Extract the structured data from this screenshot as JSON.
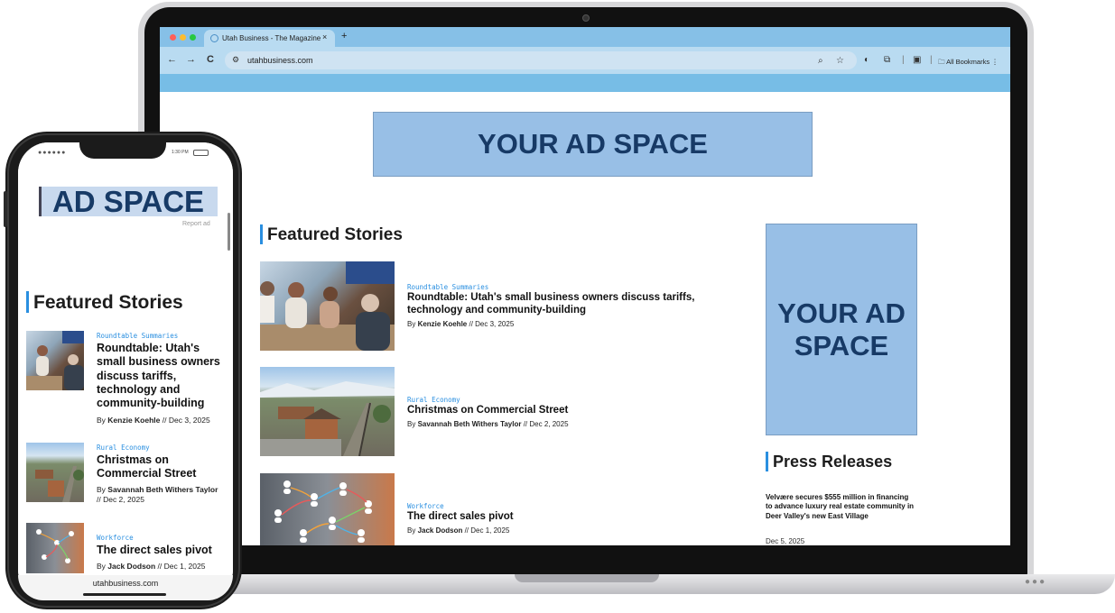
{
  "browser": {
    "tab_title": "Utah Business - The Magazine",
    "tab_close": "×",
    "new_tab": "+",
    "back": "←",
    "forward": "→",
    "reload": "C",
    "url": "utahbusiness.com",
    "all_bookmarks": "All Bookmarks",
    "traffic_colors": [
      "#ff5f57",
      "#febc2e",
      "#28c840"
    ]
  },
  "laptop_page": {
    "top_ad": "YOUR AD SPACE",
    "featured_title": "Featured Stories",
    "stories": [
      {
        "category": "Roundtable Summaries",
        "title": "Roundtable: Utah's small business owners discuss tariffs, technology and community-building",
        "by": "By ",
        "author": "Kenzie Koehle",
        "date": " // Dec 3, 2025"
      },
      {
        "category": "Rural Economy",
        "title": "Christmas on Commercial Street",
        "by": "By ",
        "author": "Savannah Beth Withers Taylor",
        "date": " // Dec 2, 2025"
      },
      {
        "category": "Workforce",
        "title": "The direct sales pivot",
        "by": "By ",
        "author": "Jack Dodson",
        "date": " // Dec 1, 2025"
      }
    ],
    "side_ad": "YOUR AD SPACE",
    "press_title": "Press Releases",
    "press_item_title": "Velvære secures $555 million in financing to advance luxury real estate community in Deer Valley's new East Village",
    "press_item_date": "Dec 5, 2025"
  },
  "phone": {
    "status_time": "1:30 PM",
    "ad": "AD SPACE",
    "report_ad": "Report ad",
    "featured_title": "Featured Stories",
    "stories": [
      {
        "category": "Roundtable Summaries",
        "title": "Roundtable: Utah's small business owners discuss tariffs, technology and community-building",
        "by": "By ",
        "author": "Kenzie Koehle",
        "date": " // Dec 3, 2025"
      },
      {
        "category": "Rural Economy",
        "title": "Christmas on Commercial Street",
        "by": "By ",
        "author": "Savannah Beth Withers Taylor",
        "date": " // Dec 2, 2025"
      },
      {
        "category": "Workforce",
        "title": "The direct sales pivot",
        "by": "By ",
        "author": "Jack Dodson",
        "date": " // Dec 1, 2025"
      }
    ],
    "url": "utahbusiness.com"
  },
  "colors": {
    "accent": "#2a8fe0",
    "ad_fill": "#98bfe6",
    "ad_text": "#173a66",
    "chrome": "#b9dbf1"
  }
}
